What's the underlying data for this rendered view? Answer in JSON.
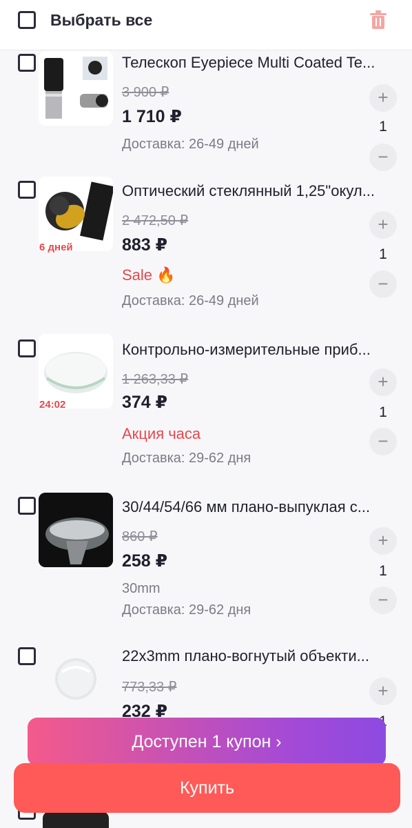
{
  "header": {
    "select_all_label": "Выбрать все",
    "delete_icon": "trash-icon"
  },
  "colors": {
    "accent_red": "#e8474b",
    "buy_button": "#ff5a57",
    "coupon_start": "#f45a8a",
    "coupon_end": "#8d4ae0"
  },
  "items": [
    {
      "title": "Телескоп Eyepiece Multi Coated Te...",
      "old_price": "3 900 ₽",
      "price": "1 710 ₽",
      "delivery": "Доставка: 26-49 дней",
      "quantity": "1",
      "timer": "",
      "tag": "",
      "variant": ""
    },
    {
      "title": "Оптический стеклянный 1,25\"окул...",
      "old_price": "2 472,50 ₽",
      "price": "883 ₽",
      "tag": "Sale 🔥",
      "delivery": "Доставка: 26-49 дней",
      "quantity": "1",
      "timer": "6 дней",
      "variant": ""
    },
    {
      "title": "Контрольно-измерительные приб...",
      "old_price": "1 263,33 ₽",
      "price": "374 ₽",
      "tag": "Акция часа",
      "delivery": "Доставка: 29-62 дня",
      "quantity": "1",
      "timer": "24:02",
      "variant": ""
    },
    {
      "title": "30/44/54/66 мм плано-выпуклая с...",
      "old_price": "860 ₽",
      "price": "258 ₽",
      "variant": "30mm",
      "delivery": "Доставка: 29-62 дня",
      "quantity": "1",
      "timer": "",
      "tag": ""
    },
    {
      "title": "22x3mm плано-вогнутый объекти...",
      "old_price": "773,33 ₽",
      "price": "232 ₽",
      "quantity": "1",
      "timer": "",
      "tag": "",
      "variant": "",
      "delivery": ""
    }
  ],
  "coupon": {
    "label": "Доступен 1 купон ›"
  },
  "buy": {
    "label": "Купить"
  }
}
